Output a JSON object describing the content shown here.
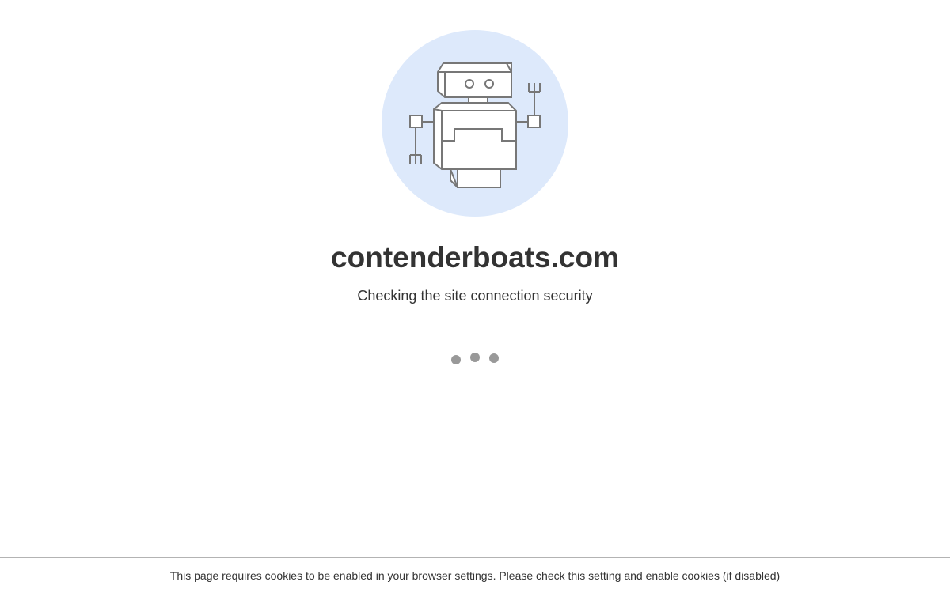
{
  "domain": "contenderboats.com",
  "status": "Checking the site connection security",
  "footer": {
    "cookie_notice": "This page requires cookies to be enabled in your browser settings. Please check this setting and enable cookies (if disabled)"
  },
  "illustration": {
    "icon": "robot-icon",
    "circle_color": "#dde9fb",
    "stroke_color": "#777777"
  },
  "loader": {
    "dot_count": 3,
    "dot_color": "#999999"
  },
  "colors": {
    "text": "#333333",
    "background": "#ffffff",
    "divider": "#b3b3b3"
  }
}
